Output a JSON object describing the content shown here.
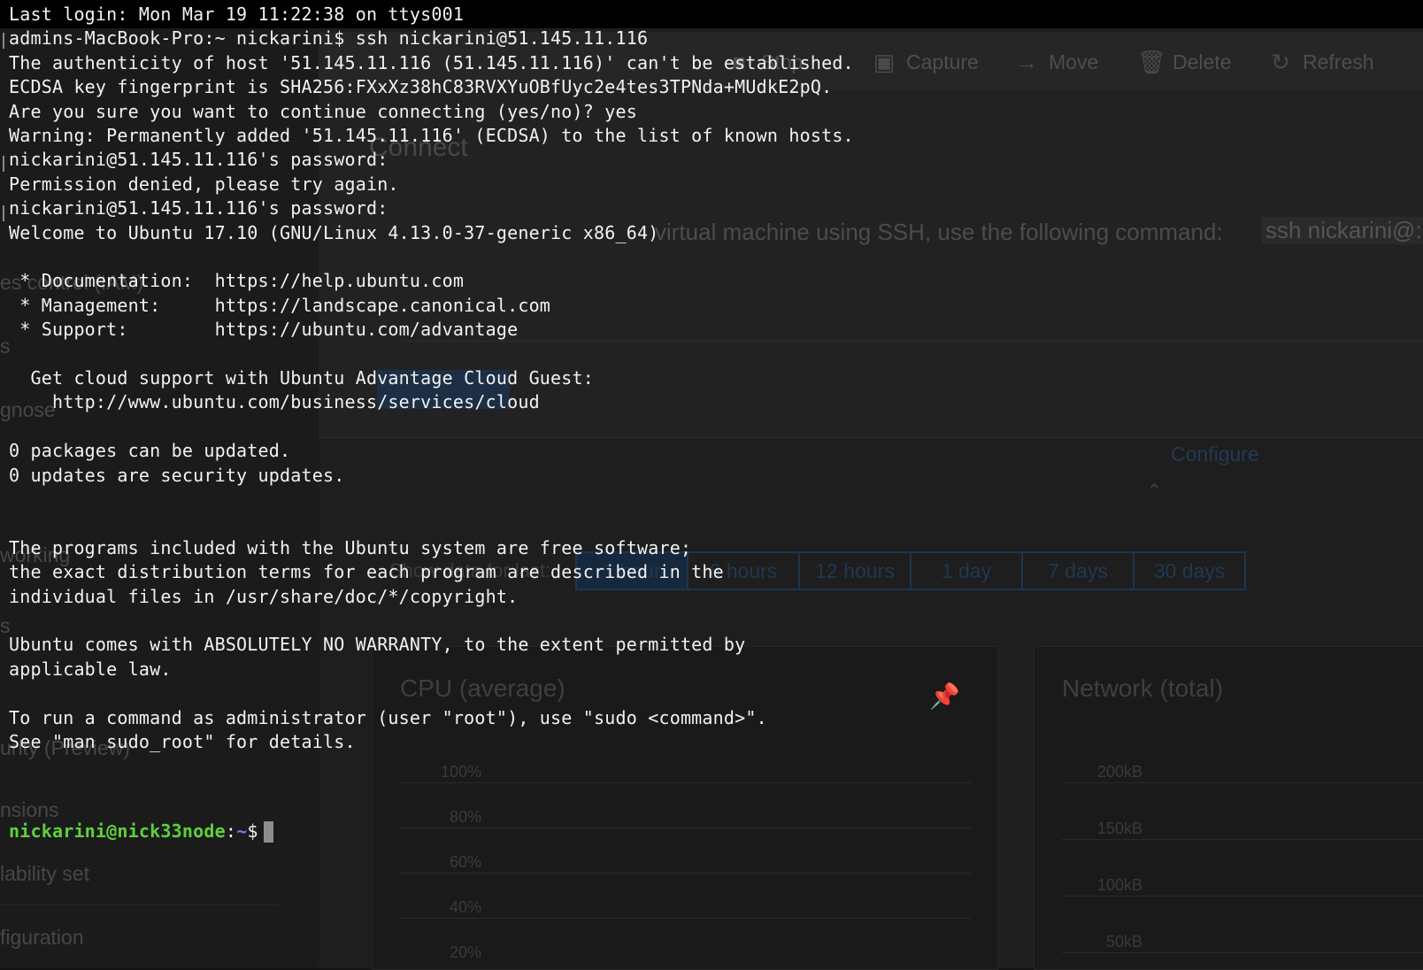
{
  "background": {
    "toolbar": [
      {
        "icon": "stop-icon",
        "label": "Stop"
      },
      {
        "icon": "capture-icon",
        "label": "Capture"
      },
      {
        "icon": "move-arrow-icon",
        "label": "Move"
      },
      {
        "icon": "trash-icon",
        "label": "Delete"
      },
      {
        "icon": "refresh-icon",
        "label": "Refresh"
      }
    ],
    "connect_title": "Connect",
    "connect_desc": "virtual machine using SSH, use the following command:",
    "connect_command": "ssh nickarini@:",
    "configure": "Configure",
    "show_data_label": "Show data for last:",
    "time_ranges": [
      "1 hour",
      "6 hours",
      "12 hours",
      "1 day",
      "7 days",
      "30 days"
    ],
    "selected_range": "1 hour",
    "cpu_card_title": "CPU (average)",
    "cpu_ticks": [
      "100%",
      "80%",
      "60%",
      "40%",
      "20%"
    ],
    "network_card_title": "Network (total)",
    "network_ticks": [
      "200kB",
      "150kB",
      "100kB",
      "50kB"
    ],
    "sidebar_fragments": [
      "es control (IAM)",
      "s",
      "gnose",
      "working",
      "s",
      "urity (Preview)",
      "nsions",
      "lability set",
      "figuration"
    ]
  },
  "terminal": {
    "lines": [
      "Last login: Mon Mar 19 11:22:38 on ttys001",
      "admins-MacBook-Pro:~ nickarini$ ssh nickarini@51.145.11.116",
      "The authenticity of host '51.145.11.116 (51.145.11.116)' can't be established.",
      "ECDSA key fingerprint is SHA256:FXxXz38hC83RVXYuOBfUyc2e4tes3TPNda+MUdkE2pQ.",
      "Are you sure you want to continue connecting (yes/no)? yes",
      "Warning: Permanently added '51.145.11.116' (ECDSA) to the list of known hosts.",
      "nickarini@51.145.11.116's password:",
      "Permission denied, please try again.",
      "nickarini@51.145.11.116's password:",
      "Welcome to Ubuntu 17.10 (GNU/Linux 4.13.0-37-generic x86_64)",
      "",
      " * Documentation:  https://help.ubuntu.com",
      " * Management:     https://landscape.canonical.com",
      " * Support:        https://ubuntu.com/advantage",
      "",
      "  Get cloud support with Ubuntu Advantage Cloud Guest:",
      "    http://www.ubuntu.com/business/services/cloud",
      "",
      "0 packages can be updated.",
      "0 updates are security updates.",
      "",
      "",
      "The programs included with the Ubuntu system are free software;",
      "the exact distribution terms for each program are described in the",
      "individual files in /usr/share/doc/*/copyright.",
      "",
      "Ubuntu comes with ABSOLUTELY NO WARRANTY, to the extent permitted by",
      "applicable law.",
      "",
      "To run a command as administrator (user \"root\"), use \"sudo <command>\".",
      "See \"man sudo_root\" for details.",
      ""
    ],
    "prompt": {
      "user_host": "nickarini@nick33node",
      "colon": ":",
      "path": "~",
      "dollar": "$"
    },
    "colors": {
      "prompt_user": "#5ed13c",
      "prompt_path": "#6a78ff",
      "text": "#f2f2f2"
    }
  }
}
